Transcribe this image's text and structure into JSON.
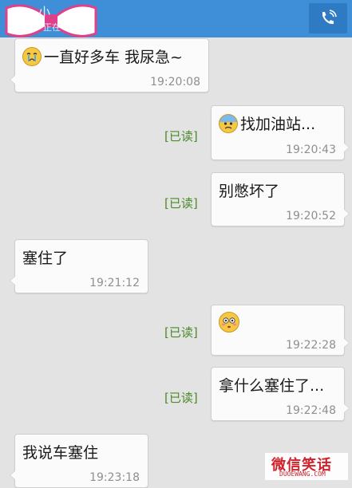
{
  "header": {
    "title": "小",
    "status": "正在",
    "call_icon": "phone-call-icon",
    "sticker_icon": "pink-bow-sticker"
  },
  "read_label": "[已读]",
  "messages": [
    {
      "side": "left",
      "text": "一直好多车 我尿急~",
      "time": "19:20:08",
      "emoji": "crying-face"
    },
    {
      "side": "right",
      "text": "找加油站...",
      "time": "19:20:43",
      "emoji": "anxious-sweat-face",
      "read": true
    },
    {
      "side": "right",
      "text": "别憋坏了",
      "time": "19:20:52",
      "read": true
    },
    {
      "side": "left",
      "text": "塞住了",
      "time": "19:21:12"
    },
    {
      "side": "right",
      "text": "",
      "time": "19:22:28",
      "emoji": "flushed-face",
      "read": true
    },
    {
      "side": "right",
      "text": "拿什么塞住了...",
      "time": "19:22:48",
      "read": true
    },
    {
      "side": "left",
      "text": "我说车塞住",
      "time": "19:23:18"
    }
  ],
  "watermark": {
    "title": "微信笑话",
    "url": "DUOEWANG.COM"
  },
  "colors": {
    "header": "#3e8fd7",
    "background": "#e3e3e3",
    "read_status": "#4a8a2a"
  }
}
